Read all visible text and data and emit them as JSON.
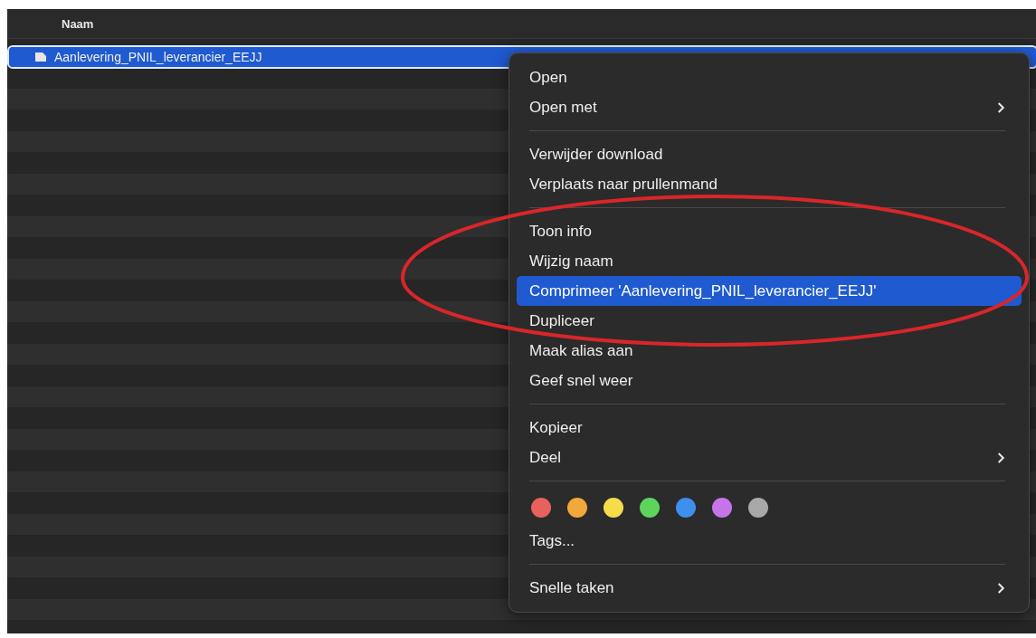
{
  "list": {
    "column": "Naam",
    "rows": [
      {
        "name": "Aanlevering_PNIL_leverancier_EEJJ",
        "selected": true
      }
    ]
  },
  "context_menu": {
    "items": [
      {
        "kind": "item",
        "label": "Open",
        "submenu": false,
        "selected": false
      },
      {
        "kind": "item",
        "label": "Open met",
        "submenu": true,
        "selected": false
      },
      {
        "kind": "separator"
      },
      {
        "kind": "item",
        "label": "Verwijder download",
        "submenu": false,
        "selected": false
      },
      {
        "kind": "item",
        "label": "Verplaats naar prullenmand",
        "submenu": false,
        "selected": false
      },
      {
        "kind": "separator"
      },
      {
        "kind": "item",
        "label": "Toon info",
        "submenu": false,
        "selected": false
      },
      {
        "kind": "item",
        "label": "Wijzig naam",
        "submenu": false,
        "selected": false
      },
      {
        "kind": "item",
        "label": "Comprimeer 'Aanlevering_PNIL_leverancier_EEJJ'",
        "submenu": false,
        "selected": true
      },
      {
        "kind": "item",
        "label": "Dupliceer",
        "submenu": false,
        "selected": false
      },
      {
        "kind": "item",
        "label": "Maak alias aan",
        "submenu": false,
        "selected": false
      },
      {
        "kind": "item",
        "label": "Geef snel weer",
        "submenu": false,
        "selected": false
      },
      {
        "kind": "separator"
      },
      {
        "kind": "item",
        "label": "Kopieer",
        "submenu": false,
        "selected": false
      },
      {
        "kind": "item",
        "label": "Deel",
        "submenu": true,
        "selected": false
      },
      {
        "kind": "separator"
      },
      {
        "kind": "tags",
        "dots": [
          {
            "color": "#e8615c"
          },
          {
            "color": "#f2a83b"
          },
          {
            "color": "#f5dc4a"
          },
          {
            "color": "#5ed45c"
          },
          {
            "color": "#3d8ff0"
          },
          {
            "color": "#c774e8"
          },
          {
            "color": "#a8a8a8"
          }
        ]
      },
      {
        "kind": "item",
        "label": "Tags...",
        "submenu": false,
        "selected": false
      },
      {
        "kind": "separator"
      },
      {
        "kind": "item",
        "label": "Snelle taken",
        "submenu": true,
        "selected": false
      }
    ]
  }
}
